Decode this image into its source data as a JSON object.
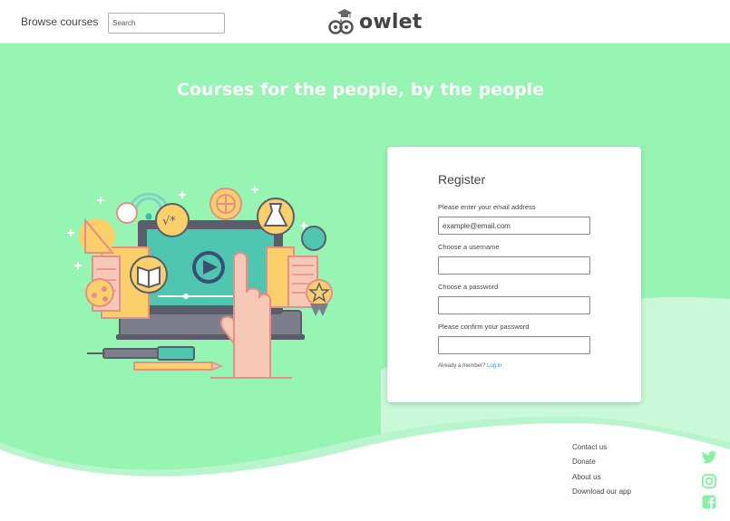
{
  "header": {
    "browse_label": "Browse courses",
    "search_placeholder": "Search",
    "logo_text": "owlet"
  },
  "hero": {
    "title": "Courses for the people, by the people"
  },
  "register": {
    "title": "Register",
    "email_label": "Please enter your email address",
    "email_placeholder": "example@email.com",
    "username_label": "Choose a username",
    "password_label": "Choose a password",
    "confirm_label": "Please confirm your password",
    "member_text": "Already a member?",
    "login_link": "Log in"
  },
  "footer": {
    "links": [
      "Contact us",
      "Donate",
      "About us",
      "Download our app"
    ],
    "social_icons": [
      "twitter-icon",
      "instagram-icon",
      "facebook-icon"
    ]
  },
  "colors": {
    "hero_bg": "#96f5b2",
    "wave_light": "#c9f9d8",
    "social_green": "#8bf0a6",
    "link_blue": "#3a8fd6"
  }
}
